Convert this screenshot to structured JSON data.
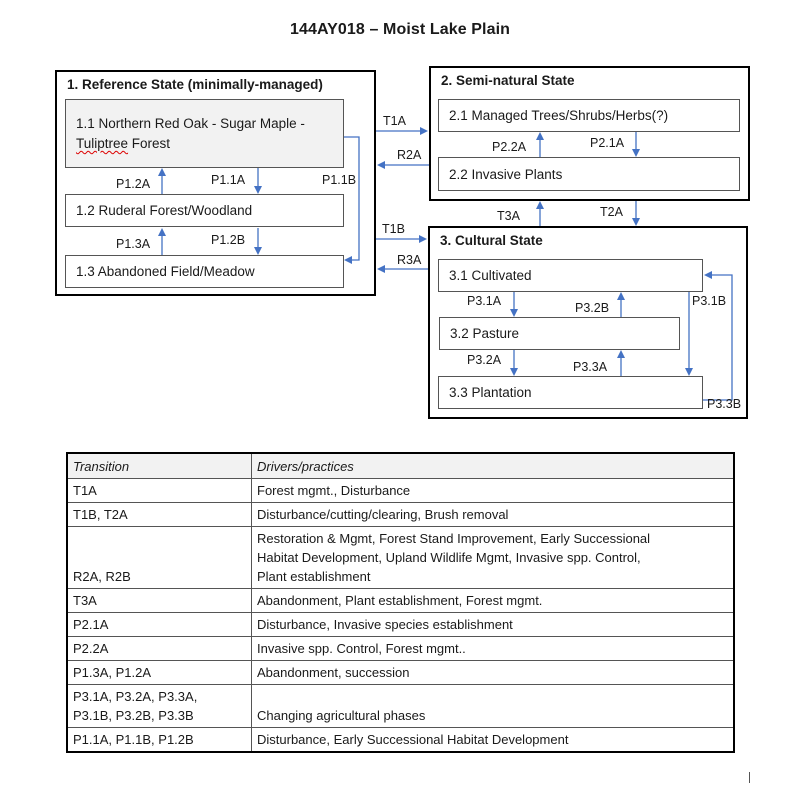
{
  "title": "144AY018 – Moist Lake Plain",
  "colors": {
    "arrow": "#4472c4",
    "shaded_phase": "#f2f2f2",
    "border": "#000000"
  },
  "states": [
    {
      "title": "1.  Reference State (minimally-managed)",
      "phases": [
        {
          "label_pre": "1.1  Northern Red Oak - Sugar Maple -",
          "label_squiggle": "Tuliptree",
          "label_post": " Forest"
        },
        {
          "label": "1.2  Ruderal Forest/Woodland"
        },
        {
          "label": "1.3  Abandoned Field/Meadow"
        }
      ]
    },
    {
      "title": "2.  Semi-natural State",
      "phases": [
        {
          "label": "2.1  Managed Trees/Shrubs/Herbs(?)"
        },
        {
          "label": "2.2  Invasive Plants"
        }
      ]
    },
    {
      "title": "3.  Cultural State",
      "phases": [
        {
          "label": "3.1  Cultivated"
        },
        {
          "label": "3.2  Pasture"
        },
        {
          "label": "3.3  Plantation"
        }
      ]
    }
  ],
  "pathways": {
    "p1_2a": "P1.2A",
    "p1_1a": "P1.1A",
    "p1_1b": "P1.1B",
    "p1_3a": "P1.3A",
    "p1_2b": "P1.2B",
    "p2_2a": "P2.2A",
    "p2_1a": "P2.1A",
    "p3_1a": "P3.1A",
    "p3_2b": "P3.2B",
    "p3_1b": "P3.1B",
    "p3_2a": "P3.2A",
    "p3_3a": "P3.3A",
    "p3_3b": "P3.3B"
  },
  "transitions": {
    "t1a": "T1A",
    "r2a": "R2A",
    "t1b": "T1B",
    "r3a": "R3A",
    "t3a": "T3A",
    "t2a": "T2A"
  },
  "table": {
    "headers": [
      "Transition",
      "Drivers/practices"
    ],
    "rows": [
      {
        "transition": "T1A",
        "drivers": "Forest mgmt., Disturbance"
      },
      {
        "transition": "T1B, T2A",
        "drivers": "Disturbance/cutting/clearing, Brush removal"
      },
      {
        "transition": "R2A, R2B",
        "drivers_lines": [
          "Restoration & Mgmt, Forest Stand Improvement, Early Successional",
          "Habitat Development, Upland Wildlife Mgmt, Invasive spp. Control,",
          "Plant establishment"
        ]
      },
      {
        "transition": "T3A",
        "drivers": "Abandonment, Plant establishment, Forest mgmt."
      },
      {
        "transition": "P2.1A",
        "drivers": "Disturbance, Invasive species establishment"
      },
      {
        "transition": "P2.2A",
        "drivers": "Invasive spp. Control, Forest mgmt.."
      },
      {
        "transition": "P1.3A, P1.2A",
        "drivers": "Abandonment, succession"
      },
      {
        "transition_lines": [
          "P3.1A, P3.2A, P3.3A,",
          "P3.1B, P3.2B, P3.3B"
        ],
        "drivers": "Changing agricultural phases"
      },
      {
        "transition": "P1.1A, P1.1B, P1.2B",
        "drivers": "Disturbance, Early Successional Habitat Development"
      }
    ]
  }
}
